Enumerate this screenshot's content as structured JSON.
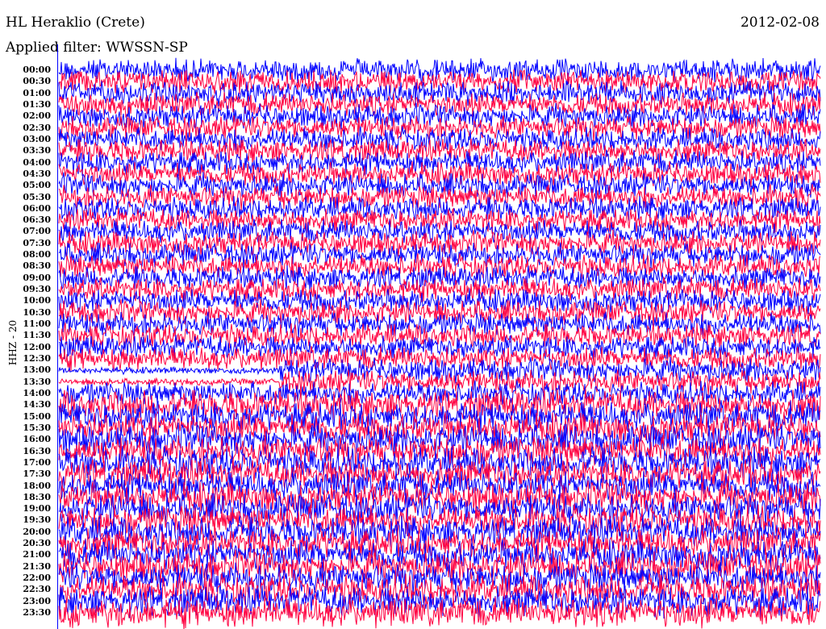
{
  "header": {
    "station": "HL Heraklio (Crete)",
    "date": "2012-02-08",
    "filter": "Applied filter: WWSSN-SP"
  },
  "chart_data": {
    "type": "line",
    "title": "HL Heraklio (Crete)",
    "subtitle": "Applied filter: WWSSN-SP",
    "date": "2012-02-08",
    "ylabel": "HHZ - 20",
    "xlabel": "",
    "row_interval_minutes": 30,
    "colors": [
      "#0000ff",
      "#ff0040"
    ],
    "rows": [
      "00:00",
      "00:30",
      "01:00",
      "01:30",
      "02:00",
      "02:30",
      "03:00",
      "03:30",
      "04:00",
      "04:30",
      "05:00",
      "05:30",
      "06:00",
      "06:30",
      "07:00",
      "07:30",
      "08:00",
      "08:30",
      "09:00",
      "09:30",
      "10:00",
      "10:30",
      "11:00",
      "11:30",
      "12:00",
      "12:30",
      "13:00",
      "13:30",
      "14:00",
      "14:30",
      "15:00",
      "15:30",
      "16:00",
      "16:30",
      "17:00",
      "17:30",
      "18:00",
      "18:30",
      "19:00",
      "19:30",
      "20:00",
      "20:30",
      "21:00",
      "21:30",
      "22:00",
      "22:30",
      "23:00",
      "23:30"
    ],
    "quiet_segment": {
      "rows": [
        "13:00",
        "13:30"
      ],
      "minutes": [
        0,
        8.7
      ]
    }
  }
}
